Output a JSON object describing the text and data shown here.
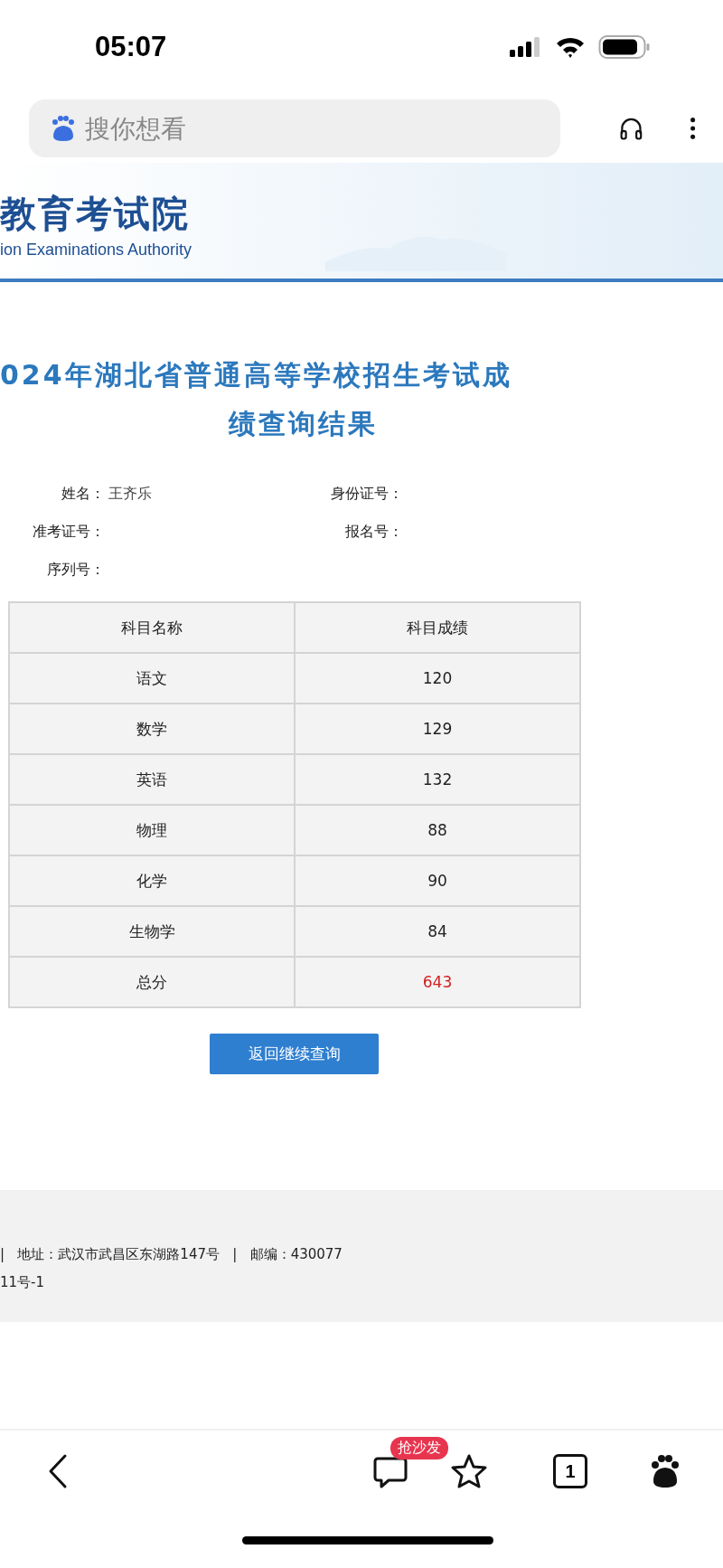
{
  "status_bar": {
    "time": "05:07"
  },
  "browser": {
    "search": {
      "placeholder": "搜你想看"
    }
  },
  "banner": {
    "title": "教育考试院",
    "subtitle": "ion Examinations Authority"
  },
  "heading": {
    "lines": [
      "024年湖北省普通高等学校招生考试成",
      "绩查询结果"
    ]
  },
  "info": {
    "left": [
      {
        "label": "姓名：",
        "value": "王齐乐"
      },
      {
        "label": "准考证号："
      },
      {
        "label": "序列号："
      }
    ],
    "right": [
      {
        "label": "身份证号："
      },
      {
        "label": "报名号："
      }
    ]
  },
  "table": {
    "columns": [
      "科目名称",
      "科目成绩"
    ],
    "rows": [
      {
        "kind": "subject",
        "name": "语文",
        "score": "120"
      },
      {
        "kind": "subject",
        "name": "数学",
        "score": "129"
      },
      {
        "kind": "subject",
        "name": "英语",
        "score": "132"
      },
      {
        "kind": "subject",
        "name": "物理",
        "score": "88"
      },
      {
        "kind": "subject",
        "name": "化学",
        "score": "90"
      },
      {
        "kind": "subject",
        "name": "生物学",
        "score": "84"
      },
      {
        "kind": "total",
        "name": "总分",
        "score": "643"
      }
    ]
  },
  "button": "返回继续查询",
  "footer": {
    "lines": [
      "|   地址：武汉市武昌区东湖路147号   |   邮编：430077",
      "11号-1"
    ]
  },
  "toolbar": {
    "badge": "抢沙发",
    "tabs": "1"
  }
}
